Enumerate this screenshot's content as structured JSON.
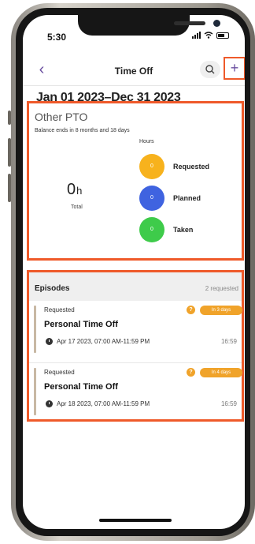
{
  "status_bar": {
    "time": "5:30"
  },
  "header": {
    "back_label": "‹",
    "title": "Time Off",
    "search_label": "🔍",
    "add_label": "+"
  },
  "date_range": "Jan 01 2023–Dec 31 2023",
  "pto": {
    "title": "Other PTO",
    "balance_text": "Balance ends in 8 months and 18 days",
    "hours_label": "Hours",
    "total_value": "0",
    "total_unit": "h",
    "total_label": "Total",
    "legend": [
      {
        "value": "0",
        "label": "Requested",
        "color": "#f7b21d"
      },
      {
        "value": "0",
        "label": "Planned",
        "color": "#3f63e0"
      },
      {
        "value": "0",
        "label": "Taken",
        "color": "#3ecb4a"
      }
    ]
  },
  "episodes": {
    "title": "Episodes",
    "count": "2 requested",
    "items": [
      {
        "status": "Requested",
        "title": "Personal Time Off",
        "date": "Apr 17 2023, 07:00 AM-11:59 PM",
        "time": "16:59",
        "badge": "In 3 days",
        "question": "?"
      },
      {
        "status": "Requested",
        "title": "Personal Time Off",
        "date": "Apr 18 2023, 07:00 AM-11:59 PM",
        "time": "16:59",
        "badge": "In 4 days",
        "question": "?"
      }
    ]
  }
}
